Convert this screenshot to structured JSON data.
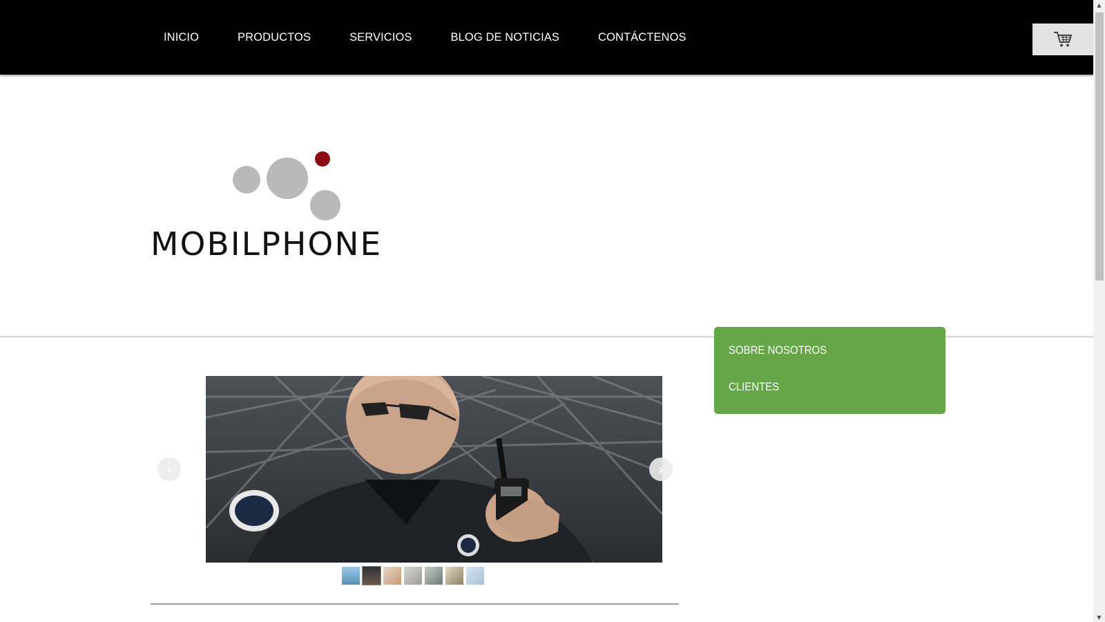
{
  "nav": {
    "items": [
      {
        "label": "INICIO"
      },
      {
        "label": "PRODUCTOS"
      },
      {
        "label": "SERVICIOS"
      },
      {
        "label": "BLOG DE NOTICIAS"
      },
      {
        "label": "CONTÁCTENOS"
      }
    ],
    "cart_icon": "shopping-cart-icon"
  },
  "logo": {
    "text": "MOBILPHONE",
    "dot_color": "#8b0a14",
    "circle_color": "#b9b9b9"
  },
  "side_menu": {
    "items": [
      {
        "label": "SOBRE NOSOTROS"
      },
      {
        "label": "CLIENTES"
      }
    ],
    "color": "#65a748"
  },
  "slider": {
    "prev_icon": "chevron-left-icon",
    "next_icon": "chevron-right-icon",
    "thumbnail_count": 7,
    "active_thumbnail": 2
  }
}
